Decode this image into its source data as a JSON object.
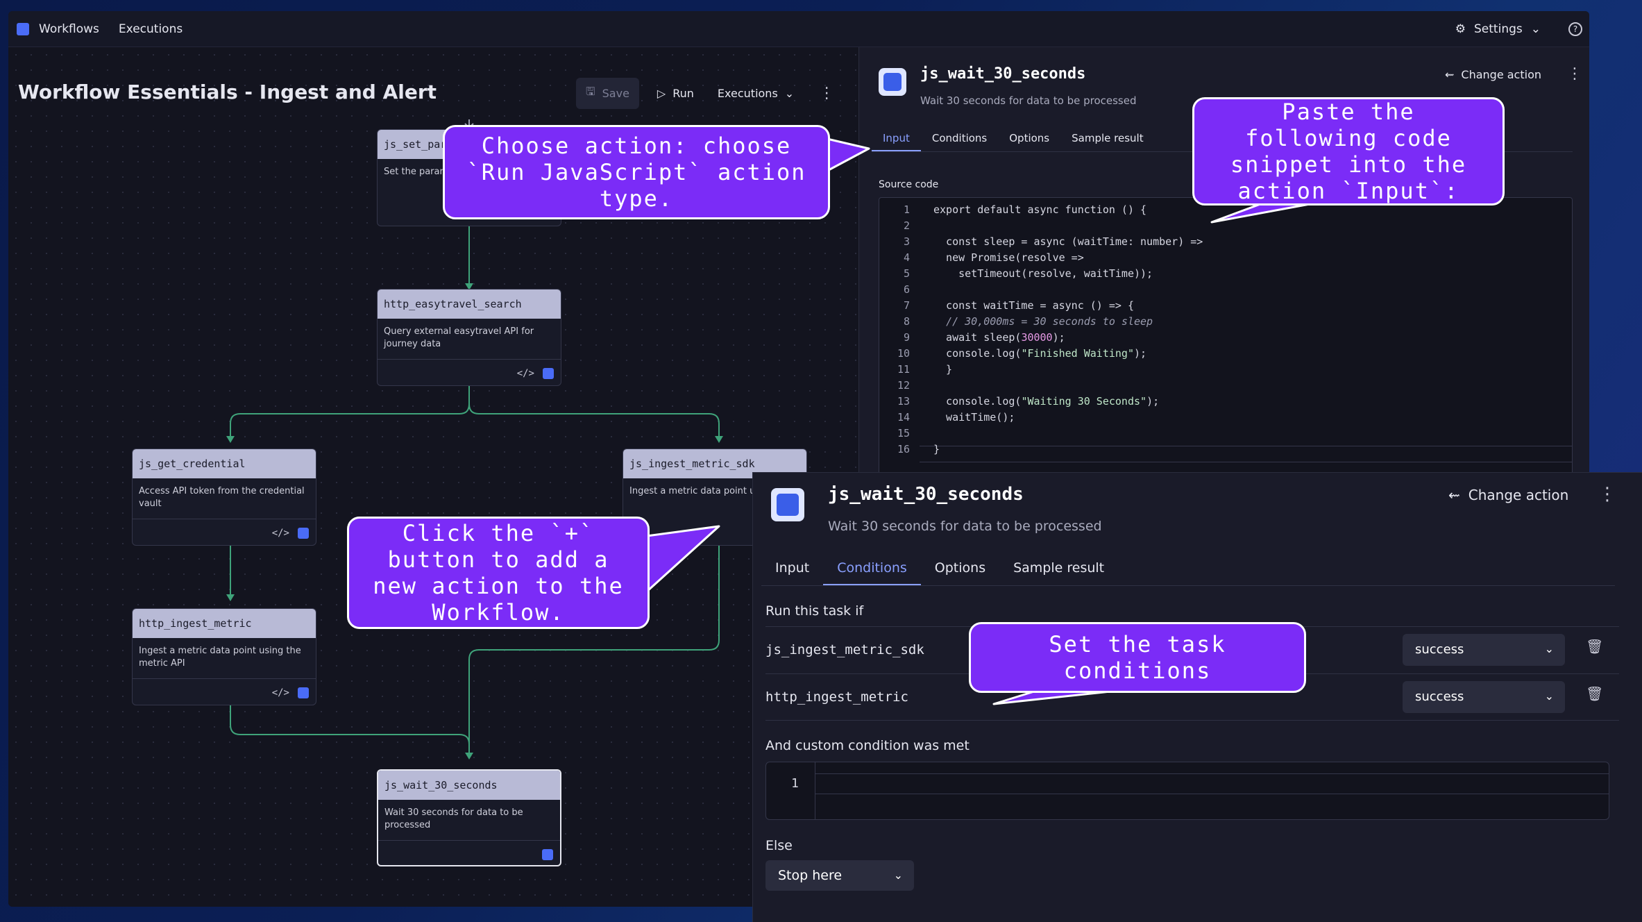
{
  "topbar": {
    "nav_workflows": "Workflows",
    "nav_executions": "Executions",
    "settings": "Settings"
  },
  "workflow": {
    "title": "Workflow Essentials - Ingest and Alert",
    "save": "Save",
    "run": "Run",
    "executions": "Executions"
  },
  "nodes": [
    {
      "name": "js_set_para",
      "desc": "Set the paran"
    },
    {
      "name": "http_easytravel_search",
      "desc": "Query external easytravel API for journey data"
    },
    {
      "name": "js_get_credential",
      "desc": "Access API token from the credential vault"
    },
    {
      "name": "js_ingest_metric_sdk",
      "desc": "Ingest a metric data point us SDK"
    },
    {
      "name": "http_ingest_metric",
      "desc": "Ingest a metric data point using the metric API"
    },
    {
      "name": "js_wait_30_seconds",
      "desc": "Wait 30 seconds for data to be processed"
    }
  ],
  "action_panel": {
    "title": "js_wait_30_seconds",
    "subtitle": "Wait 30 seconds for data to be processed",
    "change_action": "Change action",
    "tabs": [
      "Input",
      "Conditions",
      "Options",
      "Sample result"
    ],
    "source_label": "Source code",
    "line_numbers": [
      "1",
      "2",
      "3",
      "4",
      "5",
      "6",
      "7",
      "8",
      "9",
      "10",
      "11",
      "12",
      "13",
      "14",
      "15",
      "16"
    ]
  },
  "conditions_panel": {
    "title": "js_wait_30_seconds",
    "subtitle": "Wait 30 seconds for data to be processed",
    "change_action": "Change action",
    "tabs": [
      "Input",
      "Conditions",
      "Options",
      "Sample result"
    ],
    "run_if": "Run this task if",
    "rows": [
      {
        "task": "js_ingest_metric_sdk",
        "state": "success"
      },
      {
        "task": "http_ingest_metric",
        "state": "success"
      }
    ],
    "custom_label": "And custom condition was met",
    "custom_line": "1",
    "else_label": "Else",
    "else_value": "Stop here"
  },
  "callouts": {
    "choose_action": "Choose action: choose `Run JavaScript` action type.",
    "paste_snippet": "Paste the following code snippet into the action `Input`:",
    "click_plus": "Click the `+` button to add a new action to the Workflow.",
    "set_conditions": "Set the task conditions"
  },
  "colors": {
    "accent": "#8aa0ff",
    "callout": "#7b2cf7",
    "edge": "#3fa37a"
  }
}
